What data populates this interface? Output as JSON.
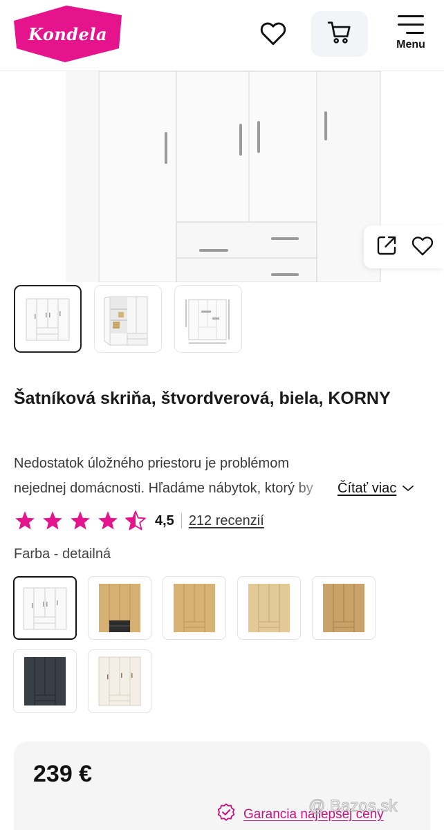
{
  "header": {
    "logo_text": "Kondela",
    "menu_label": "Menu",
    "icons": {
      "favorite": "heart-icon",
      "cart": "cart-icon",
      "menu": "hamburger-icon"
    }
  },
  "brand_colors": {
    "primary": "#e5138c",
    "accent_text": "#c2157f"
  },
  "gallery": {
    "thumbnails": [
      "wardrobe-front",
      "wardrobe-open",
      "wardrobe-dimensions"
    ],
    "active_index": 0,
    "actions": {
      "share": "share-icon",
      "favorite": "heart-icon"
    }
  },
  "product": {
    "title": "Šatníková skriňa, štvordverová, biela, KORNY",
    "description": "Nedostatok úložného priestoru je problémom nejednej domácnosti. Hľadáme nábytok, ktorý by mal s",
    "read_more": "Čítať viac"
  },
  "rating": {
    "value": "4,5",
    "score": 4.5,
    "max": 5,
    "reviews": "212 recenzií"
  },
  "color": {
    "label": "Farba - detailná",
    "variants": [
      "white",
      "oak-black",
      "oak",
      "oak-light",
      "oak-rustic",
      "anthracite",
      "cream"
    ],
    "selected_index": 0
  },
  "price": {
    "amount": "239 €",
    "guarantee": "Garancia najlepšej ceny"
  },
  "watermark": "@ Bazos.sk"
}
